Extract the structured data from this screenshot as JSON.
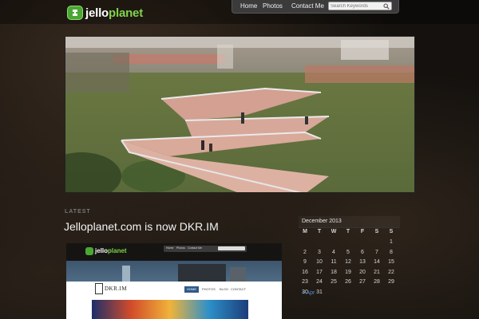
{
  "brand": {
    "part1": "jello",
    "part2": "planet",
    "accent": "#7fd34b"
  },
  "nav": {
    "items": [
      {
        "label": "Home"
      },
      {
        "label": "Photos"
      },
      {
        "label": "Contact Me"
      }
    ],
    "search_placeholder": "Search Keywords"
  },
  "main": {
    "section_label": "LATEST",
    "post_title": "Jelloplanet.com is now DKR.IM",
    "thumbnail": {
      "logo_part1": "jello",
      "logo_part2": "planet",
      "nav_items": [
        "Home",
        "Photos",
        "Contact Me"
      ],
      "dkr_title": "DKR.IM",
      "dkr_nav": [
        "HOME",
        "PHOTOS",
        "BLOG",
        "CONTACT"
      ]
    }
  },
  "calendar": {
    "month": "December 2013",
    "weekdays": [
      "M",
      "T",
      "W",
      "T",
      "F",
      "S",
      "S"
    ],
    "weeks": [
      [
        "",
        "",
        "",
        "",
        "",
        "",
        "1"
      ],
      [
        "2",
        "3",
        "4",
        "5",
        "6",
        "7",
        "8"
      ],
      [
        "9",
        "10",
        "11",
        "12",
        "13",
        "14",
        "15"
      ],
      [
        "16",
        "17",
        "18",
        "19",
        "20",
        "21",
        "22"
      ],
      [
        "23",
        "24",
        "25",
        "26",
        "27",
        "28",
        "29"
      ],
      [
        "30",
        "31",
        "",
        "",
        "",
        "",
        ""
      ]
    ],
    "prev_link": "« Apr"
  }
}
